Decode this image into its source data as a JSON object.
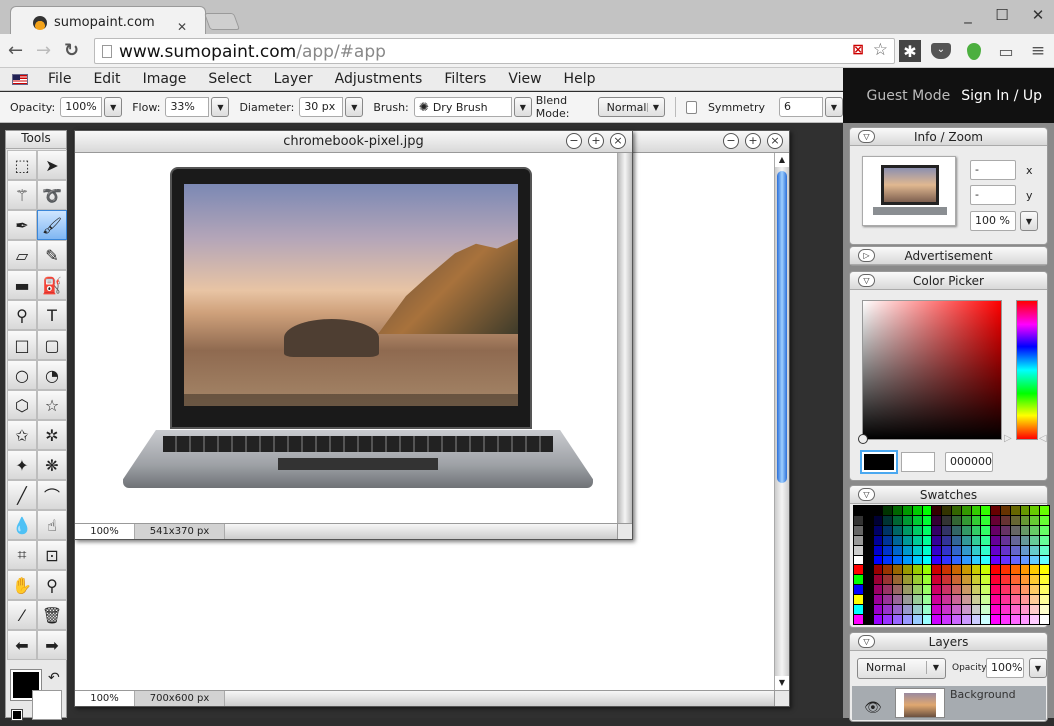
{
  "browser": {
    "tab_title": "sumopaint.com",
    "url_host": "www.sumopaint.com",
    "url_path": "/app/#app",
    "window_controls": [
      "minimize",
      "maximize",
      "close"
    ],
    "extensions": [
      "blocked-plugin-icon",
      "bookmark-star-icon",
      "asterisk-extension-icon",
      "pocket-icon",
      "evernote-icon",
      "cast-icon",
      "menu-icon"
    ]
  },
  "menubar": {
    "items": [
      "File",
      "Edit",
      "Image",
      "Select",
      "Layer",
      "Adjustments",
      "Filters",
      "View",
      "Help"
    ]
  },
  "options": {
    "opacity_label": "Opacity:",
    "opacity_value": "100%",
    "flow_label": "Flow:",
    "flow_value": "33%",
    "diameter_label": "Diameter:",
    "diameter_value": "30 px",
    "brush_label": "Brush:",
    "brush_value": "Dry Brush",
    "blend_label": "Blend Mode:",
    "blend_value": "Normal",
    "symmetry_label": "Symmetry",
    "symmetry_checked": false,
    "symmetry_value": "6"
  },
  "user": {
    "guest_mode": "Guest Mode",
    "sign_in": "Sign In / Up"
  },
  "tools": {
    "title": "Tools",
    "items": [
      {
        "name": "rectangle-select",
        "glyph": "⬚"
      },
      {
        "name": "move",
        "glyph": "➤"
      },
      {
        "name": "magic-wand",
        "glyph": "⚚"
      },
      {
        "name": "lasso",
        "glyph": "➰"
      },
      {
        "name": "pen",
        "glyph": "✒"
      },
      {
        "name": "brush",
        "glyph": "🖌",
        "active": true
      },
      {
        "name": "eraser",
        "glyph": "▱"
      },
      {
        "name": "pencil",
        "glyph": "✎"
      },
      {
        "name": "gradient",
        "glyph": "▬"
      },
      {
        "name": "paint-bucket",
        "glyph": "⛽"
      },
      {
        "name": "clone-stamp",
        "glyph": "⚲"
      },
      {
        "name": "text",
        "glyph": "T"
      },
      {
        "name": "rectangle",
        "glyph": "□"
      },
      {
        "name": "rounded-rectangle",
        "glyph": "▢"
      },
      {
        "name": "ellipse",
        "glyph": "○"
      },
      {
        "name": "pie",
        "glyph": "◔"
      },
      {
        "name": "hexagon",
        "glyph": "⬡"
      },
      {
        "name": "star",
        "glyph": "☆"
      },
      {
        "name": "star-6",
        "glyph": "✩"
      },
      {
        "name": "burst",
        "glyph": "✲"
      },
      {
        "name": "blob-shape",
        "glyph": "✦"
      },
      {
        "name": "flower-shape",
        "glyph": "❋"
      },
      {
        "name": "line",
        "glyph": "╱"
      },
      {
        "name": "curve",
        "glyph": "⌒"
      },
      {
        "name": "blur-drop",
        "glyph": "💧"
      },
      {
        "name": "smudge",
        "glyph": "☝"
      },
      {
        "name": "crop",
        "glyph": "⌗"
      },
      {
        "name": "transform",
        "glyph": "⊡"
      },
      {
        "name": "hand",
        "glyph": "✋"
      },
      {
        "name": "zoom",
        "glyph": "⚲"
      },
      {
        "name": "eyedropper",
        "glyph": "⁄"
      },
      {
        "name": "trash",
        "glyph": "🗑"
      },
      {
        "name": "arrow-left",
        "glyph": "⬅"
      },
      {
        "name": "arrow-right",
        "glyph": "➡"
      }
    ],
    "foreground": "#000000",
    "background": "#ffffff"
  },
  "documents": [
    {
      "title": "chromebook-pixel.jpg",
      "zoom": "100%",
      "size": "541x370 px"
    },
    {
      "title": "",
      "zoom": "100%",
      "size": "700x600 px"
    }
  ],
  "panels": {
    "info": {
      "title": "Info / Zoom",
      "x_value": "-",
      "y_value": "-",
      "x_label": "x",
      "y_label": "y",
      "zoom_value": "100 %"
    },
    "advertisement": {
      "title": "Advertisement"
    },
    "color_picker": {
      "title": "Color Picker",
      "hex_value": "000000",
      "hue": "#ff0000"
    },
    "swatches": {
      "title": "Swatches"
    },
    "layers": {
      "title": "Layers",
      "blend": "Normal",
      "opacity_label": "Opacity:",
      "opacity_value": "100%",
      "layer_names": [
        "Background"
      ]
    }
  }
}
